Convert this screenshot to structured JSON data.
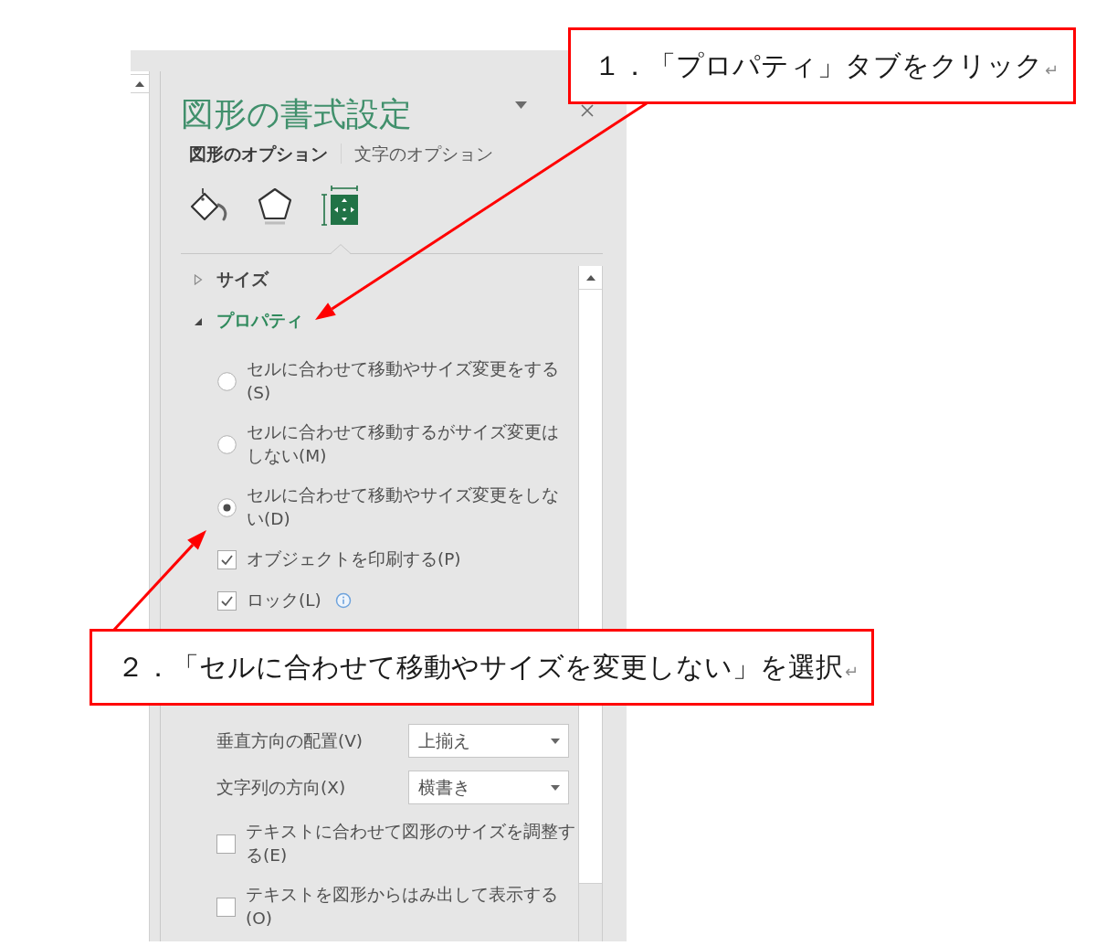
{
  "pane": {
    "title": "図形の書式設定",
    "tabs": [
      {
        "label": "図形のオプション",
        "selected": true
      },
      {
        "label": "文字のオプション",
        "selected": false
      }
    ],
    "icon_tabs": [
      {
        "kind": "fill",
        "selected": false
      },
      {
        "kind": "shape",
        "selected": false
      },
      {
        "kind": "size",
        "selected": true
      }
    ],
    "sections": [
      {
        "label": "サイズ",
        "expanded": false
      },
      {
        "label": "プロパティ",
        "expanded": true,
        "controls": [
          {
            "kind": "radio",
            "label": "セルに合わせて移動やサイズ変更をする(S)",
            "selected": false
          },
          {
            "kind": "radio",
            "label": "セルに合わせて移動するがサイズ変更はしない(M)",
            "selected": false
          },
          {
            "kind": "radio",
            "label": "セルに合わせて移動やサイズ変更をしない(D)",
            "selected": true
          },
          {
            "kind": "checkbox",
            "label": "オブジェクトを印刷する(P)",
            "checked": true
          },
          {
            "kind": "checkbox",
            "label": "ロック(L)",
            "checked": true,
            "info": true
          }
        ]
      }
    ],
    "lower_controls": [
      {
        "kind": "select",
        "label": "垂直方向の配置(V)",
        "value": "上揃え"
      },
      {
        "kind": "select",
        "label": "文字列の方向(X)",
        "value": "横書き"
      },
      {
        "kind": "checkbox",
        "label": "テキストに合わせて図形のサイズを調整する(E)",
        "checked": false
      },
      {
        "kind": "checkbox",
        "label": "テキストを図形からはみ出して表示する(O)",
        "checked": false
      }
    ]
  },
  "callouts": [
    {
      "text": "１．「プロパティ」タブをクリック",
      "mark": "↵"
    },
    {
      "text": "２．「セルに合わせて移動やサイズを変更しない」を選択",
      "mark": "↵"
    }
  ]
}
